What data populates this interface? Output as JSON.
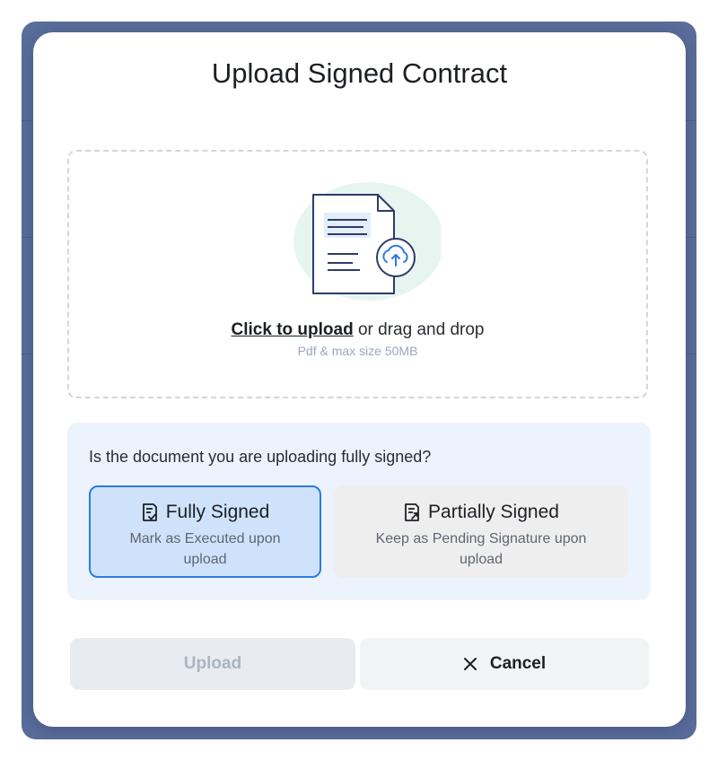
{
  "dialog": {
    "title": "Upload Signed Contract"
  },
  "dropzone": {
    "link_text": "Click to upload",
    "rest_text": " or drag and drop",
    "hint": "Pdf & max size 50MB"
  },
  "question": {
    "text": "Is the document you are uploading fully signed?",
    "options": [
      {
        "label": "Fully Signed",
        "description": "Mark as Executed upon upload",
        "icon": "document-check-icon",
        "selected": true
      },
      {
        "label": "Partially Signed",
        "description": "Keep as Pending Signature upon upload",
        "icon": "document-pending-icon",
        "selected": false
      }
    ]
  },
  "actions": {
    "upload_label": "Upload",
    "upload_disabled": true,
    "cancel_label": "Cancel",
    "cancel_icon": "close-icon"
  },
  "colors": {
    "accent": "#2b7be4",
    "selected_bg": "#cfe2fb",
    "panel_bg": "#ecf3fd",
    "illustration_blob": "#e6f5ef"
  }
}
